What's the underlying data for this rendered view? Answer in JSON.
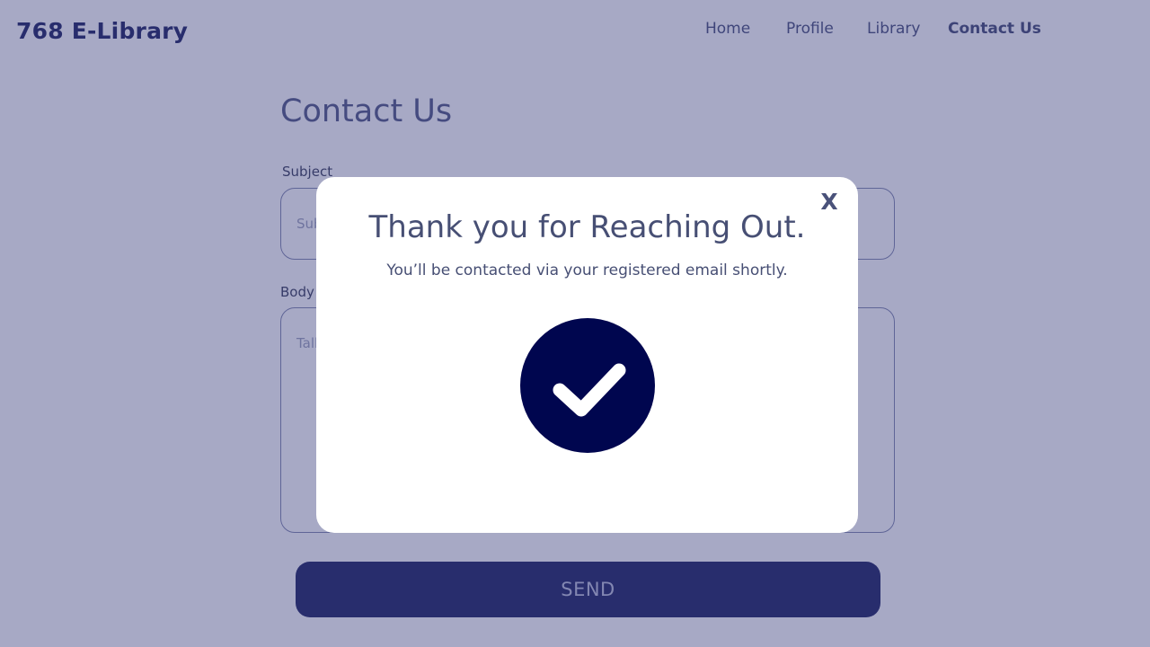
{
  "header": {
    "brand": "768 E-Library",
    "nav": [
      {
        "label": "Home"
      },
      {
        "label": "Profile"
      },
      {
        "label": "Library"
      },
      {
        "label": "Contact Us",
        "active": true
      }
    ]
  },
  "form": {
    "title": "Contact Us",
    "subject": {
      "label": "Subject",
      "placeholder": "Sub"
    },
    "body": {
      "label": "Body",
      "placeholder": "Talk"
    },
    "send_label": "SEND"
  },
  "modal": {
    "close_label": "X",
    "title": "Thank you for Reaching Out.",
    "subtitle": "You’ll be contacted via your registered email shortly.",
    "icon": "checkmark-circle-icon"
  },
  "colors": {
    "brand": "#00064f",
    "overlay": "#a9aac6",
    "modal_bg": "#ffffff",
    "text": "#474f74"
  }
}
